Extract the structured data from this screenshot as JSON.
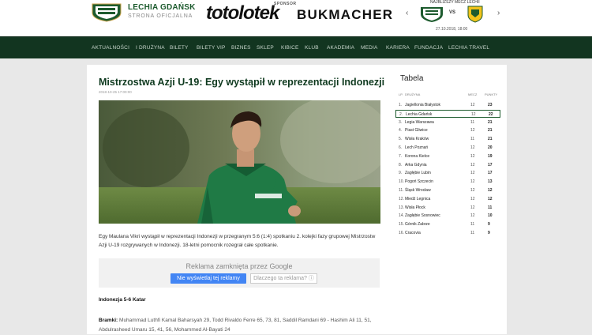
{
  "header": {
    "club_name": "LECHIA GDAŃSK",
    "club_sub": "STRONA OFICJALNA",
    "sponsor_label": "SPONSOR",
    "sponsor_brand_a": "totolotek",
    "sponsor_brand_b": "BUKMACHER",
    "next_match_label": "NAJBLIŻSZY MECZ LECHII",
    "vs": "VS",
    "match_date": "27.10.2018, 18:00"
  },
  "nav": {
    "items": [
      "AKTUALNOŚCI",
      "I DRUŻYNA",
      "BILETY",
      "BILETY VIP",
      "BIZNES",
      "SKLEP",
      "KIBICE",
      "KLUB",
      "AKADEMIA",
      "MEDIA",
      "KARIERA",
      "FUNDACJA",
      "LECHIA TRAVEL"
    ]
  },
  "article": {
    "title": "Mistrzostwa Azji U-19: Egy wystąpił w reprezentacji Indonezji",
    "date": "2018-10-25 17:00:00",
    "lede": "Egy Maulana Vikri wystąpił w reprezentacji Indonezji w przegranym 5:6 (1:4) spotkaniu 2. kolejki fazy grupowej Mistrzostw Azji U-19 rozgrywanych w Indonezji. 18-letni pomocnik rozegrał całe spotkanie.",
    "section_head": "Indonezja 5-6 Katar",
    "goals_label": "Bramki:",
    "goals_text": "Muhammad Luthfi Kamal Baharsyah 29, Todd Rivaldo Ferre 65, 73, 81, Saddil Ramdani 69 - Hashim Ali 11, 51, Abdulrasheed Umaru 15, 41, 56, Mohammed Al-Bayati 24"
  },
  "ad": {
    "title": "Reklama zamknięta przez Google",
    "button": "Nie wyświetlaj tej reklamy",
    "why": "Dlaczego ta reklama? ⓘ"
  },
  "table": {
    "title": "Tabela",
    "headers": {
      "pos": "LP.",
      "team": "DRUŻYNA",
      "gp": "MECZ",
      "pts": "PUNKTY"
    },
    "rows": [
      {
        "pos": "1.",
        "team": "Jagiellonia Białystok",
        "gp": "12",
        "pts": "23"
      },
      {
        "pos": "2.",
        "team": "Lechia Gdańsk",
        "gp": "12",
        "pts": "22"
      },
      {
        "pos": "3.",
        "team": "Legia Warszawa",
        "gp": "11",
        "pts": "21"
      },
      {
        "pos": "4.",
        "team": "Piast Gliwice",
        "gp": "12",
        "pts": "21"
      },
      {
        "pos": "5.",
        "team": "Wisła Kraków",
        "gp": "11",
        "pts": "21"
      },
      {
        "pos": "6.",
        "team": "Lech Poznań",
        "gp": "12",
        "pts": "20"
      },
      {
        "pos": "7.",
        "team": "Korona Kielce",
        "gp": "12",
        "pts": "19"
      },
      {
        "pos": "8.",
        "team": "Arka Gdynia",
        "gp": "12",
        "pts": "17"
      },
      {
        "pos": "9.",
        "team": "Zagłębie Lubin",
        "gp": "12",
        "pts": "17"
      },
      {
        "pos": "10.",
        "team": "Pogoń Szczecin",
        "gp": "12",
        "pts": "13"
      },
      {
        "pos": "11.",
        "team": "Śląsk Wrocław",
        "gp": "12",
        "pts": "12"
      },
      {
        "pos": "12.",
        "team": "Miedź Legnica",
        "gp": "12",
        "pts": "12"
      },
      {
        "pos": "13.",
        "team": "Wisła Płock",
        "gp": "12",
        "pts": "11"
      },
      {
        "pos": "14.",
        "team": "Zagłębie Sosnowiec",
        "gp": "12",
        "pts": "10"
      },
      {
        "pos": "15.",
        "team": "Górnik Zabrze",
        "gp": "11",
        "pts": "9"
      },
      {
        "pos": "16.",
        "team": "Cracovia",
        "gp": "11",
        "pts": "9"
      }
    ]
  }
}
